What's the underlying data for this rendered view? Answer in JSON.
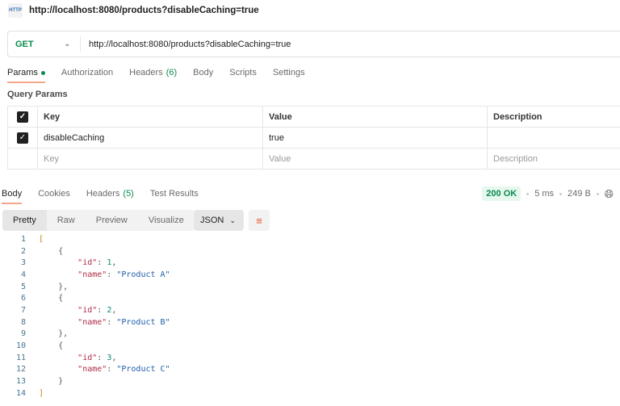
{
  "title": "http://localhost:8080/products?disableCaching=true",
  "request": {
    "method": "GET",
    "url": "http://localhost:8080/products?disableCaching=true"
  },
  "req_tabs": [
    {
      "label": "Params",
      "dot": true
    },
    {
      "label": "Authorization"
    },
    {
      "label": "Headers",
      "count": "(6)"
    },
    {
      "label": "Body"
    },
    {
      "label": "Scripts"
    },
    {
      "label": "Settings"
    }
  ],
  "query_params": {
    "title": "Query Params",
    "headers": [
      "Key",
      "Value",
      "Description"
    ],
    "rows": [
      {
        "checked": true,
        "key": "disableCaching",
        "value": "true",
        "description": ""
      }
    ],
    "placeholder": {
      "key": "Key",
      "value": "Value",
      "description": "Description"
    }
  },
  "resp_tabs": [
    {
      "label": "Body"
    },
    {
      "label": "Cookies"
    },
    {
      "label": "Headers",
      "count": "(5)"
    },
    {
      "label": "Test Results"
    }
  ],
  "status": {
    "code": "200 OK",
    "time": "5 ms",
    "size": "249 B",
    "color": "#0b8a4f"
  },
  "view_modes": [
    "Pretty",
    "Raw",
    "Preview",
    "Visualize"
  ],
  "format": "JSON",
  "code": [
    [
      [
        "br",
        "["
      ]
    ],
    [
      [
        "p",
        "    {"
      ]
    ],
    [
      [
        "p",
        "        "
      ],
      [
        "k",
        "\"id\""
      ],
      [
        "p",
        ": "
      ],
      [
        "n",
        "1"
      ],
      [
        "p",
        ","
      ]
    ],
    [
      [
        "p",
        "        "
      ],
      [
        "k",
        "\"name\""
      ],
      [
        "p",
        ": "
      ],
      [
        "s",
        "\"Product A\""
      ]
    ],
    [
      [
        "p",
        "    },"
      ]
    ],
    [
      [
        "p",
        "    {"
      ]
    ],
    [
      [
        "p",
        "        "
      ],
      [
        "k",
        "\"id\""
      ],
      [
        "p",
        ": "
      ],
      [
        "n",
        "2"
      ],
      [
        "p",
        ","
      ]
    ],
    [
      [
        "p",
        "        "
      ],
      [
        "k",
        "\"name\""
      ],
      [
        "p",
        ": "
      ],
      [
        "s",
        "\"Product B\""
      ]
    ],
    [
      [
        "p",
        "    },"
      ]
    ],
    [
      [
        "p",
        "    {"
      ]
    ],
    [
      [
        "p",
        "        "
      ],
      [
        "k",
        "\"id\""
      ],
      [
        "p",
        ": "
      ],
      [
        "n",
        "3"
      ],
      [
        "p",
        ","
      ]
    ],
    [
      [
        "p",
        "        "
      ],
      [
        "k",
        "\"name\""
      ],
      [
        "p",
        ": "
      ],
      [
        "s",
        "\"Product C\""
      ]
    ],
    [
      [
        "p",
        "    }"
      ]
    ],
    [
      [
        "br",
        "]"
      ]
    ]
  ]
}
